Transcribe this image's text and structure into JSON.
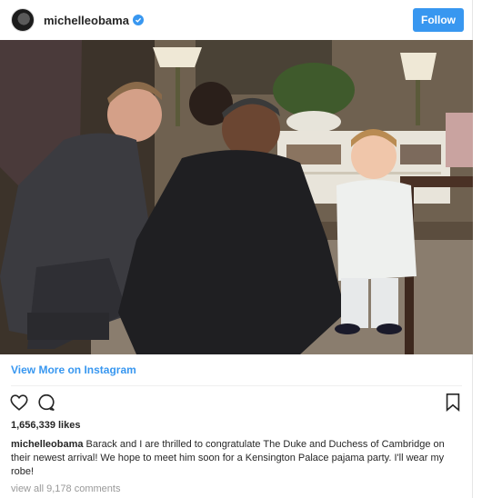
{
  "post": {
    "username": "michelleobama",
    "follow_label": "Follow",
    "view_more_label": "View More on Instagram",
    "likes_text": "1,656,339 likes",
    "caption_username": "michelleobama",
    "caption_text": "Barack and I are thrilled to congratulate The Duke and Duchess of Cambridge on their newest arrival! We hope to meet him soon for a Kensington Palace pajama party. I'll wear my robe!",
    "comments_link": "view all 9,178 comments"
  },
  "colors": {
    "accent": "#3897f0",
    "text": "#262626",
    "muted": "#999999"
  },
  "icons": [
    "verified-badge-icon",
    "heart-icon",
    "comment-icon",
    "bookmark-icon"
  ]
}
